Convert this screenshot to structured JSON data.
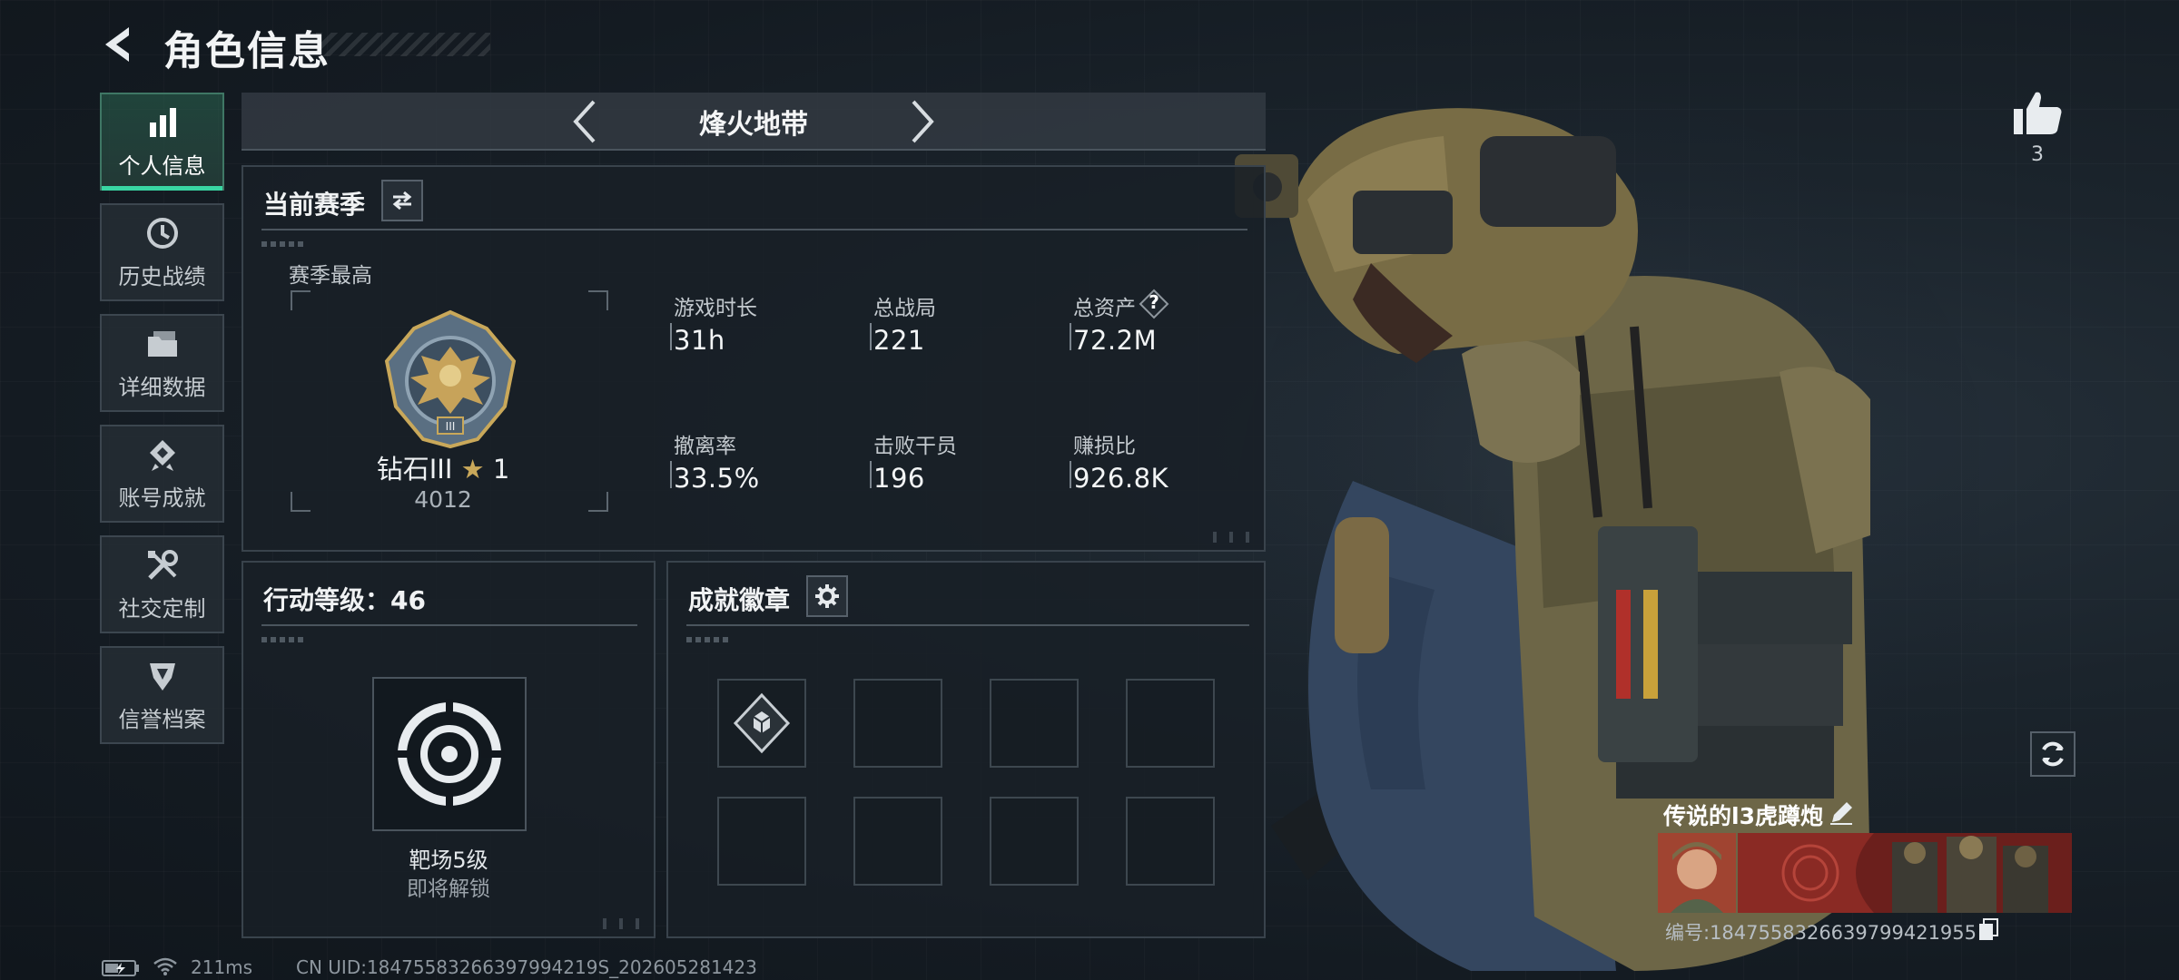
{
  "header": {
    "title": "角色信息"
  },
  "sidebar": {
    "items": [
      {
        "label": "个人信息",
        "icon": "bar-chart-icon",
        "active": true
      },
      {
        "label": "历史战绩",
        "icon": "clock-history-icon",
        "active": false
      },
      {
        "label": "详细数据",
        "icon": "folder-icon",
        "active": false
      },
      {
        "label": "账号成就",
        "icon": "achievement-icon",
        "active": false
      },
      {
        "label": "社交定制",
        "icon": "tools-icon",
        "active": false
      },
      {
        "label": "信誉档案",
        "icon": "shield-badge-icon",
        "active": false
      }
    ]
  },
  "mode": {
    "title": "烽火地带"
  },
  "season": {
    "title": "当前赛季",
    "best_label": "赛季最高",
    "rank_name": "钻石III",
    "rank_stars": "1",
    "rank_points": "4012",
    "stats": [
      {
        "label": "游戏时长",
        "value": "31h"
      },
      {
        "label": "总战局",
        "value": "221"
      },
      {
        "label": "总资产",
        "value": "72.2M"
      },
      {
        "label": "撤离率",
        "value": "33.5%"
      },
      {
        "label": "击败干员",
        "value": "196"
      },
      {
        "label": "赚损比",
        "value": "926.8K"
      }
    ],
    "help_symbol": "?"
  },
  "action_level": {
    "title": "行动等级：46",
    "unlock_name": "靶场5级",
    "unlock_status": "即将解锁"
  },
  "badges": {
    "title": "成就徽章",
    "slots": 8,
    "filled": 1
  },
  "profile": {
    "likes": "3",
    "name": "传说的l3虎蹲炮",
    "id_text": "编号:1847558326639799421955"
  },
  "status_bar": {
    "ping": "211ms",
    "uid": "CN UID:18475583266397994219S_202605281423"
  },
  "colors": {
    "accent": "#39d6a3",
    "panel_bg": "#192027",
    "text": "#e8ecef"
  }
}
